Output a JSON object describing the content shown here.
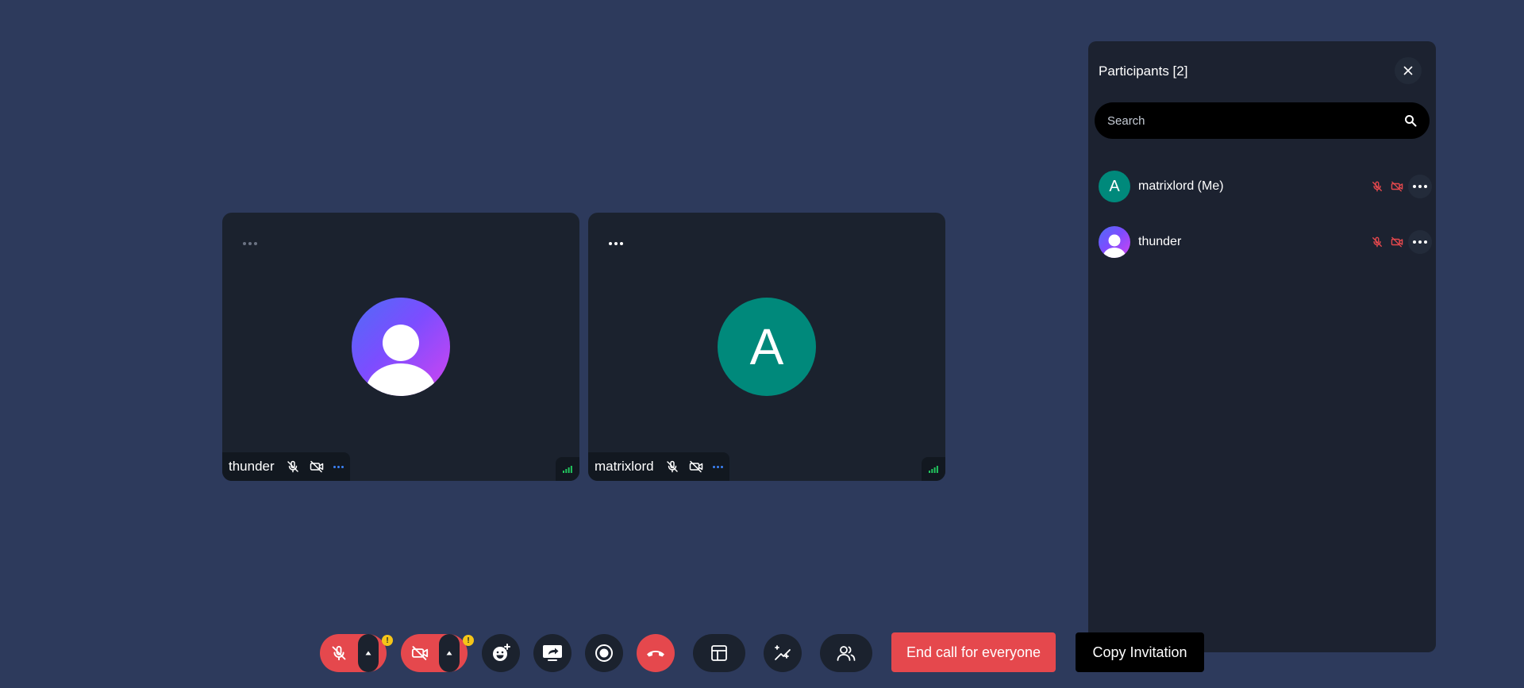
{
  "colors": {
    "background": "#2d3a5c",
    "tile": "#1b222e",
    "panel": "#1c2230",
    "danger": "#e5484d",
    "warning": "#f5c518",
    "avatar_teal": "#00897b",
    "signal_green": "#22c55e",
    "more_blue": "#3b82f6"
  },
  "tiles": [
    {
      "name": "thunder",
      "avatar": "person-icon",
      "mic": "mic-off-icon",
      "camera": "camera-off-icon",
      "menu": "more-horizontal-icon",
      "signal": "signal-bars-icon"
    },
    {
      "name": "matrixlord",
      "avatar_letter": "A",
      "mic": "mic-off-icon",
      "camera": "camera-off-icon",
      "menu": "more-horizontal-icon",
      "signal": "signal-bars-icon"
    }
  ],
  "panel": {
    "title": "Participants [2]",
    "close_icon": "close-icon",
    "search_placeholder": "Search",
    "search_icon": "search-icon",
    "participants": [
      {
        "name": "matrixlord (Me)",
        "avatar_letter": "A",
        "mic": "mic-off-icon",
        "camera": "camera-off-icon"
      },
      {
        "name": "thunder",
        "avatar": "person-icon",
        "mic": "mic-off-icon",
        "camera": "camera-off-icon"
      }
    ]
  },
  "controls": {
    "warning_mark": "!",
    "icons": [
      "mic-off-icon",
      "camera-off-icon",
      "emoji-icon",
      "screen-share-icon",
      "record-icon",
      "hang-up-icon",
      "layout-icon",
      "effects-icon",
      "participants-icon"
    ],
    "end_call_label": "End call for everyone",
    "copy_invitation_label": "Copy Invitation"
  }
}
